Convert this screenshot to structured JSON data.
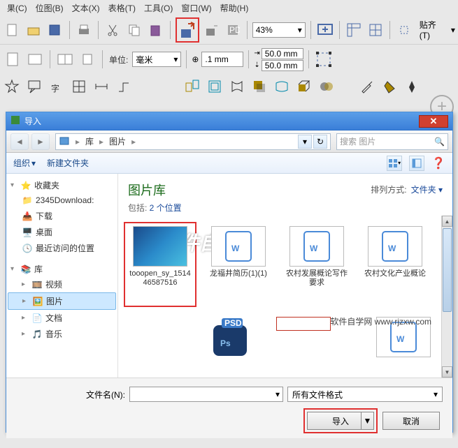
{
  "menu": {
    "items": [
      "果(C)",
      "位图(B)",
      "文本(X)",
      "表格(T)",
      "工具(O)",
      "窗口(W)",
      "帮助(H)"
    ]
  },
  "toolbar1": {
    "zoom": "43%",
    "snap_label": "贴齐(T)"
  },
  "toolbar2": {
    "unit_label": "单位:",
    "unit_value": "毫米",
    "nudge": ".1 mm",
    "dup_x": "50.0 mm",
    "dup_y": "50.0 mm"
  },
  "dialog": {
    "title": "导入",
    "nav": {
      "crumbs": [
        "库",
        "图片"
      ],
      "search_placeholder": "搜索 图片"
    },
    "toolbar": {
      "organize": "组织",
      "newfolder": "新建文件夹"
    },
    "sidebar": {
      "favorites": {
        "label": "收藏夹",
        "items": [
          "2345Download:",
          "下载",
          "桌面",
          "最近访问的位置"
        ]
      },
      "libraries": {
        "label": "库",
        "items": [
          "视频",
          "图片",
          "文档",
          "音乐"
        ]
      }
    },
    "content": {
      "title": "图片库",
      "subtitle_prefix": "包括: ",
      "subtitle_link": "2 个位置",
      "sort_label": "排列方式:",
      "sort_value": "文件夹",
      "files": [
        {
          "name": "tooopen_sy_151446587516",
          "type": "image"
        },
        {
          "name": "龙福井简历(1)(1)",
          "type": "doc"
        },
        {
          "name": "农村发展概论写作要求",
          "type": "doc"
        },
        {
          "name": "农村文化产业概论",
          "type": "doc"
        },
        {
          "name": "",
          "type": "psd"
        },
        {
          "name": "",
          "type": "banner"
        },
        {
          "name": "",
          "type": "doc"
        }
      ]
    },
    "footer": {
      "filename_label": "文件名(N):",
      "filter": "所有文件格式",
      "import_btn": "导入",
      "cancel_btn": "取消"
    }
  },
  "watermark": "软件自学网",
  "watermark2": "软件自学网 www.rjzxw.com"
}
